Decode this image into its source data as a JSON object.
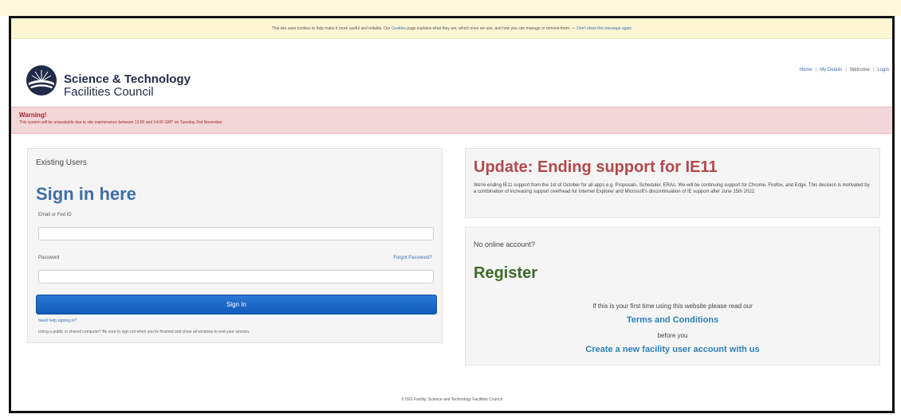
{
  "cookie_bar": {
    "text_before": "This site uses cookies to help make it more useful and reliable. Our",
    "cookies_link": "Cookies",
    "text_after": "page explains what they are, which ones we use, and how you can manage or remove them. —",
    "dismiss_link": "Don't show this message again"
  },
  "header": {
    "brand_line1": "Science & Technology",
    "brand_line2": "Facilities Council",
    "nav": {
      "home": "Home",
      "my_details": "My Details",
      "welcome": "Welcome",
      "login": "Login"
    }
  },
  "warning": {
    "title": "Warning!",
    "text": "This system will be unavailable due to site maintenance between 13:00 and 14:00 GMT on Tuesday 2nd November"
  },
  "login": {
    "heading": "Existing Users",
    "title": "Sign in here",
    "email_label": "Email or Fed ID",
    "email_value": "",
    "password_label": "Password",
    "password_value": "",
    "forgot_link": "Forgot Password?",
    "signin_button": "Sign In",
    "help_link": "Need help signing in?",
    "public_note": "Using a public or shared computer? Be sure to sign out when you've finished and close all windows to end your session."
  },
  "update": {
    "title": "Update: Ending support for IE11",
    "text": "We're ending IE11 support from the 1st of October for all apps e.g. Proposals, Scheduler, ERAs. We will be continuing support for Chrome, Firefox, and Edge. This decision is motivated by a combination of increasing support overhead for Internet Explorer and Microsoft's discontinuation of IE support after June 15th 2022."
  },
  "register": {
    "heading": "No online account?",
    "title": "Register",
    "line1": "If this is your first time using this website please read our",
    "terms_link": "Terms and Conditions",
    "line2": "before you",
    "create_link": "Create a new facility user account with us"
  },
  "footer": {
    "text": "© ISIS Facility, Science and Technology Facilities Council"
  },
  "colors": {
    "title_blue": "#3f6ea5",
    "update_red": "#b3494a",
    "register_green": "#3d6b2b",
    "button_blue": "#1468c7",
    "warning_bg": "#f2d7d9",
    "cookie_bg": "#fcf6d5"
  },
  "icons": {
    "logo": "stfc-sun-logo"
  }
}
